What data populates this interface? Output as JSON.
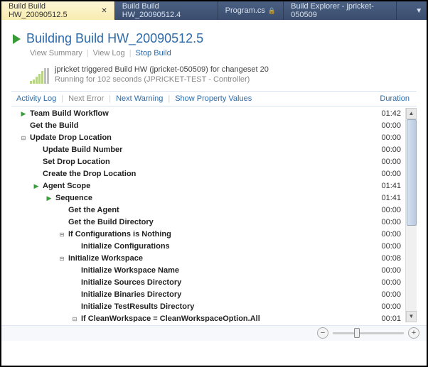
{
  "tabs": [
    {
      "label": "Build Build HW_20090512.5",
      "active": true,
      "closable": true
    },
    {
      "label": "Build Build HW_20090512.4",
      "active": false,
      "closable": false
    },
    {
      "label": "Program.cs",
      "active": false,
      "locked": true
    },
    {
      "label": "Build Explorer - jpricket-050509",
      "active": false
    }
  ],
  "header": {
    "title": "Building Build HW_20090512.5",
    "nav": {
      "summary": "View Summary",
      "log": "View Log",
      "stop": "Stop Build"
    },
    "status_line1": "jpricket triggered Build HW (jpricket-050509) for changeset 20",
    "status_line2": "Running for 102 seconds (JPRICKET-TEST - Controller)"
  },
  "filters": {
    "activity": "Activity Log",
    "next_error": "Next Error",
    "next_warning": "Next Warning",
    "show_props": "Show Property Values",
    "duration": "Duration"
  },
  "rows": [
    {
      "indent": 0,
      "exp": "green",
      "label": "Team Build Workflow",
      "bold": true,
      "time": "01:42"
    },
    {
      "indent": 0,
      "exp": "none",
      "label": "Get the Build",
      "bold": true,
      "time": "00:00"
    },
    {
      "indent": 0,
      "exp": "minus",
      "label": "Update Drop Location",
      "bold": true,
      "time": "00:00"
    },
    {
      "indent": 1,
      "exp": "none",
      "label": "Update Build Number",
      "bold": true,
      "time": "00:00"
    },
    {
      "indent": 1,
      "exp": "none",
      "label": "Set Drop Location",
      "bold": true,
      "time": "00:00"
    },
    {
      "indent": 1,
      "exp": "none",
      "label": "Create the Drop Location",
      "bold": true,
      "time": "00:00"
    },
    {
      "indent": 1,
      "exp": "green",
      "label": "Agent Scope",
      "bold": true,
      "time": "01:41"
    },
    {
      "indent": 2,
      "exp": "green",
      "label": "Sequence",
      "bold": true,
      "time": "01:41"
    },
    {
      "indent": 3,
      "exp": "none",
      "label": "Get the Agent",
      "bold": true,
      "time": "00:00"
    },
    {
      "indent": 3,
      "exp": "none",
      "label": "Get the Build Directory",
      "bold": true,
      "time": "00:00"
    },
    {
      "indent": 3,
      "exp": "minus",
      "label": "If Configurations is Nothing",
      "bold": true,
      "time": "00:00"
    },
    {
      "indent": 4,
      "exp": "none",
      "label": "Initialize Configurations",
      "bold": true,
      "time": "00:00"
    },
    {
      "indent": 3,
      "exp": "minus",
      "label": "Initialize Workspace",
      "bold": true,
      "time": "00:08"
    },
    {
      "indent": 4,
      "exp": "none",
      "label": "Initialize Workspace Name",
      "bold": true,
      "time": "00:00"
    },
    {
      "indent": 4,
      "exp": "none",
      "label": "Initialize Sources Directory",
      "bold": true,
      "time": "00:00"
    },
    {
      "indent": 4,
      "exp": "none",
      "label": "Initialize Binaries Directory",
      "bold": true,
      "time": "00:00"
    },
    {
      "indent": 4,
      "exp": "none",
      "label": "Initialize TestResults Directory",
      "bold": true,
      "time": "00:00"
    },
    {
      "indent": 4,
      "exp": "minus",
      "label": "If CleanWorkspace = CleanWorkspaceOption.All",
      "bold": true,
      "time": "00:01"
    }
  ]
}
